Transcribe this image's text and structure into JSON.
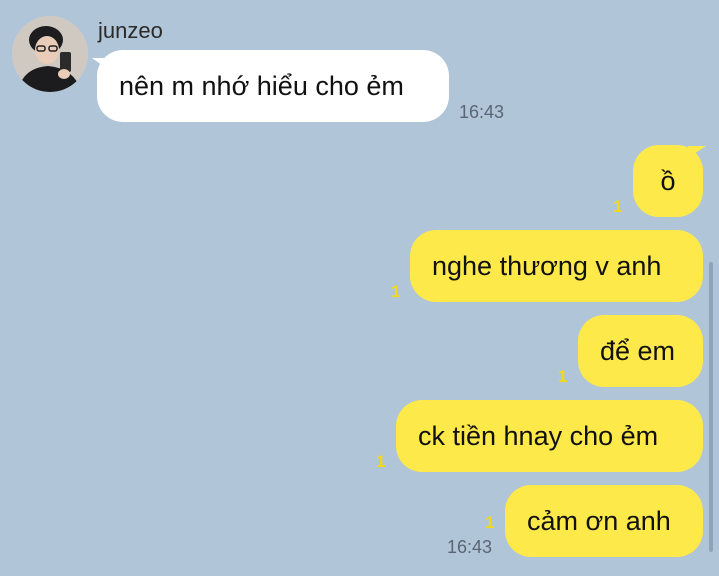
{
  "chat": {
    "sender_name": "junzeo",
    "incoming": {
      "text": "nên m nhớ hiểu cho ẻm",
      "time": "16:43"
    },
    "outgoing": [
      {
        "text": "ồ",
        "unread": "1"
      },
      {
        "text": "nghe thương v anh",
        "unread": "1"
      },
      {
        "text": "để em",
        "unread": "1"
      },
      {
        "text": "ck tiền hnay cho ẻm",
        "unread": "1"
      },
      {
        "text": "cảm ơn anh",
        "unread": "1",
        "time": "16:43"
      }
    ]
  },
  "colors": {
    "background": "#b1c5d8",
    "incoming_bubble": "#ffffff",
    "outgoing_bubble": "#fde94a",
    "unread_count": "#f2d81b"
  },
  "icons": {
    "avatar": "profile-photo"
  }
}
